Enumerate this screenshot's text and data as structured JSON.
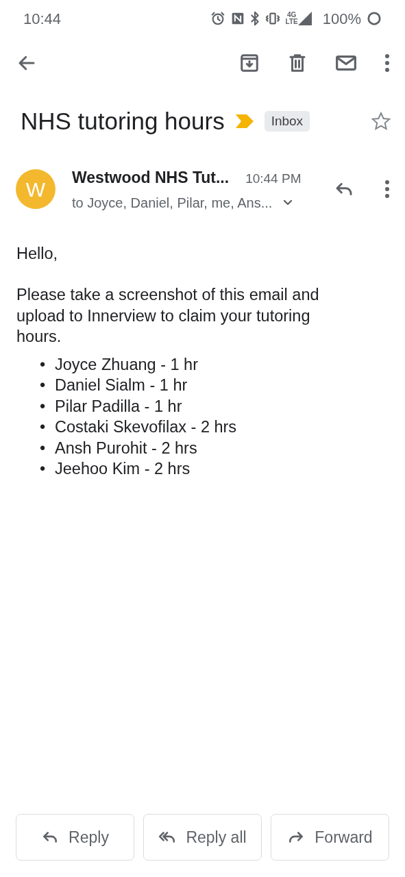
{
  "status_bar": {
    "time": "10:44",
    "network_top": "4G",
    "network_bottom": "LTE",
    "battery": "100%"
  },
  "subject": {
    "title": "NHS tutoring hours",
    "important": true,
    "label": "Inbox",
    "starred": false
  },
  "message": {
    "avatar_letter": "W",
    "sender": "Westwood NHS Tut...",
    "time": "10:44 PM",
    "recipients": "to Joyce, Daniel, Pilar, me, Ans..."
  },
  "body": {
    "greeting": "Hello,",
    "paragraph": "Please take a screenshot of this email and upload to Innerview to claim your tutoring hours.",
    "items": [
      {
        "bullet": "•",
        "text": "Joyce Zhuang - 1 hr"
      },
      {
        "bullet": "•",
        "text": "Daniel Sialm - 1 hr"
      },
      {
        "bullet": "•",
        "text": "Pilar Padilla - 1 hr"
      },
      {
        "bullet": "•",
        "text": "Costaki Skevofilax - 2 hrs"
      },
      {
        "bullet": "•",
        "text": "Ansh Purohit - 2 hrs"
      },
      {
        "bullet": "•",
        "text": "Jeehoo Kim - 2 hrs"
      }
    ]
  },
  "actions": [
    {
      "kind": "reply",
      "label": "Reply"
    },
    {
      "kind": "reply_all",
      "label": "Reply all"
    },
    {
      "kind": "forward",
      "label": "Forward"
    }
  ]
}
